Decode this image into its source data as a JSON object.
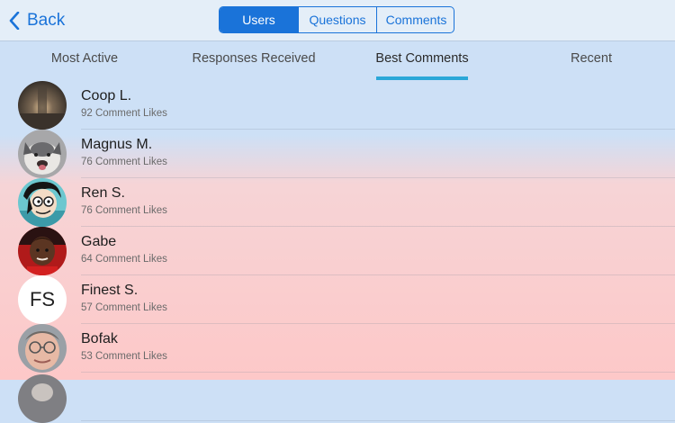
{
  "nav": {
    "back_label": "Back",
    "segments": [
      {
        "label": "Users",
        "active": true
      },
      {
        "label": "Questions",
        "active": false
      },
      {
        "label": "Comments",
        "active": false
      }
    ],
    "accent_color": "#1a73d9"
  },
  "subtabs": [
    {
      "label": "Most Active",
      "active": false
    },
    {
      "label": "Responses Received",
      "active": false
    },
    {
      "label": "Best Comments",
      "active": true
    },
    {
      "label": "Recent",
      "active": false
    }
  ],
  "users": [
    {
      "name": "Coop L.",
      "likes": "92 Comment Likes",
      "avatar": "photo-dusk"
    },
    {
      "name": "Magnus M.",
      "likes": "76 Comment Likes",
      "avatar": "photo-husky-dog"
    },
    {
      "name": "Ren S.",
      "likes": "76 Comment Likes",
      "avatar": "cartoon-face"
    },
    {
      "name": "Gabe",
      "likes": "64 Comment Likes",
      "avatar": "photo-person-red"
    },
    {
      "name": "Finest S.",
      "likes": "57 Comment Likes",
      "avatar": "initials",
      "initials": "FS"
    },
    {
      "name": "Bofak",
      "likes": "53 Comment Likes",
      "avatar": "photo-person-glasses"
    }
  ]
}
